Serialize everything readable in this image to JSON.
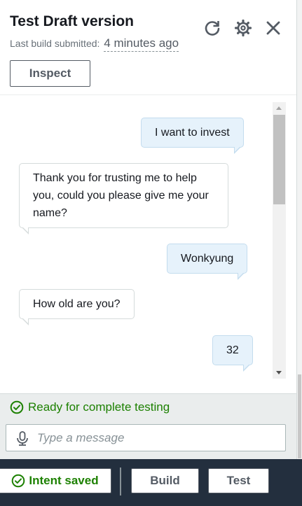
{
  "header": {
    "title": "Test Draft version",
    "subtitle_prefix": "Last build submitted:",
    "subtitle_time": "4 minutes ago",
    "icons": [
      "refresh-icon",
      "gear-icon",
      "close-icon"
    ],
    "inspect_label": "Inspect"
  },
  "chat": {
    "messages": [
      {
        "role": "user",
        "text": "I want to invest"
      },
      {
        "role": "bot",
        "text": "Thank you for trusting me to help you, could you please give me your name?"
      },
      {
        "role": "user",
        "text": "Wonkyung"
      },
      {
        "role": "bot",
        "text": "How old are you?"
      },
      {
        "role": "user",
        "text": "32"
      }
    ]
  },
  "footer": {
    "status_text": "Ready for complete testing",
    "input_value": "",
    "input_placeholder": "Type a message"
  },
  "bottom_bar": {
    "intent_label": "Intent saved",
    "build_label": "Build",
    "test_label": "Test"
  },
  "colors": {
    "success": "#1d8102",
    "user_bubble": "#e6f2fb",
    "bottom_bar": "#232f3e"
  }
}
